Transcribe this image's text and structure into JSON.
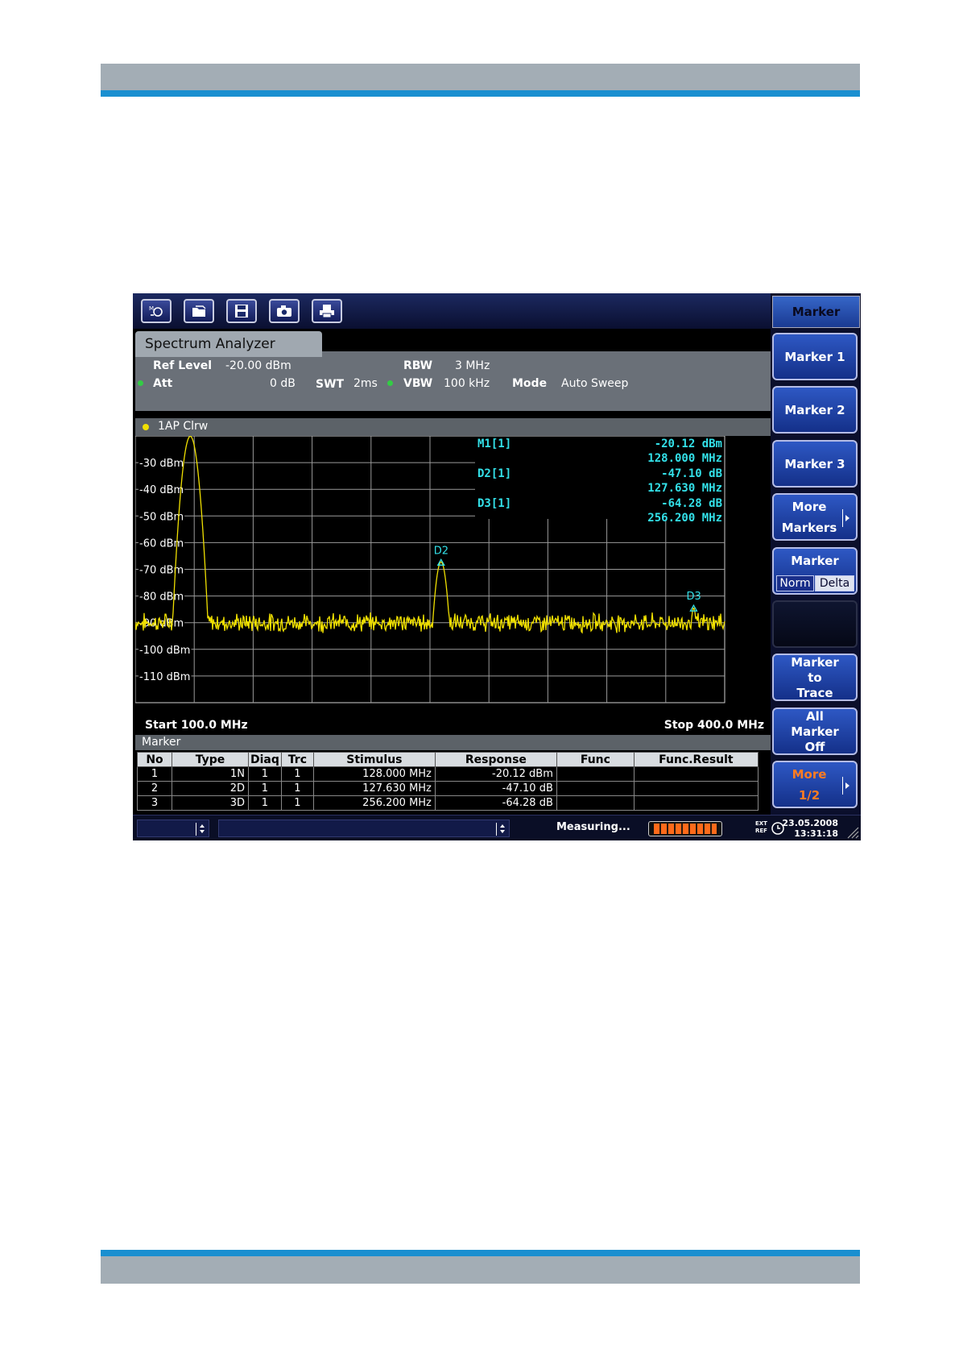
{
  "toolbar": {
    "buttons": [
      {
        "icon": "mode-icon"
      },
      {
        "icon": "open-file-icon"
      },
      {
        "icon": "save-icon"
      },
      {
        "icon": "screenshot-camera-icon"
      },
      {
        "icon": "print-icon"
      }
    ]
  },
  "tab": {
    "label": "Spectrum Analyzer"
  },
  "settings": {
    "ref_level_label": "Ref Level",
    "ref_level_value": "-20.00 dBm",
    "att_label": "Att",
    "att_value": "0 dB",
    "swt_label": "SWT",
    "swt_value": "2ms",
    "rbw_label": "RBW",
    "rbw_value": "3 MHz",
    "vbw_label": "VBW",
    "vbw_value": "100 kHz",
    "mode_label": "Mode",
    "mode_value": "Auto Sweep"
  },
  "trace": {
    "label": "1AP Clrw",
    "color": "#f0e000"
  },
  "marker_readout": [
    {
      "name": "M1[1]",
      "level": "-20.12 dBm",
      "freq": "128.000 MHz"
    },
    {
      "name": "D2[1]",
      "level": "-47.10 dB",
      "freq": "127.630 MHz"
    },
    {
      "name": "D3[1]",
      "level": "-64.28 dB",
      "freq": "256.200 MHz"
    }
  ],
  "chart_data": {
    "type": "line",
    "x_start_mhz": 100.0,
    "x_stop_mhz": 400.0,
    "start_label": "Start 100.0 MHz",
    "stop_label": "Stop 400.0 MHz",
    "y_tick_labels": [
      "-30 dBm",
      "-40 dBm",
      "-50 dBm",
      "-60 dBm",
      "-70 dBm",
      "-80 dBm",
      "-90 dBm",
      "-100 dBm",
      "-110 dBm"
    ],
    "y_tick_values": [
      -30,
      -40,
      -50,
      -60,
      -70,
      -80,
      -90,
      -100,
      -110
    ],
    "ylim": [
      -120,
      -20
    ],
    "noise_floor_dbm": -90,
    "peaks": [
      {
        "center_mhz": 128.0,
        "level_dbm": -20.12
      },
      {
        "center_mhz": 255.63,
        "level_dbm": -67.22
      },
      {
        "center_mhz": 384.2,
        "level_dbm": -84.4
      }
    ],
    "marker_labels": [
      {
        "label": "D2",
        "x_mhz": 255.63,
        "y_dbm": -67.22
      },
      {
        "label": "D3",
        "x_mhz": 384.2,
        "y_dbm": -84.4
      }
    ],
    "grid": true,
    "trace_color": "#f0e000",
    "marker_color": "#33e0e8"
  },
  "marker_table": {
    "title": "Marker",
    "columns": [
      "No",
      "Type",
      "Diaq",
      "Trc",
      "Stimulus",
      "Response",
      "Func",
      "Func.Result"
    ],
    "rows": [
      [
        "1",
        "1N",
        "1",
        "1",
        "128.000 MHz",
        "-20.12 dBm",
        "",
        ""
      ],
      [
        "2",
        "2D",
        "1",
        "1",
        "127.630 MHz",
        "-47.10 dB",
        "",
        ""
      ],
      [
        "3",
        "3D",
        "1",
        "1",
        "256.200 MHz",
        "-64.28 dB",
        "",
        ""
      ]
    ]
  },
  "softkeys": {
    "title": "Marker",
    "marker1": "Marker 1",
    "marker2": "Marker 2",
    "marker3": "Marker 3",
    "more_markers_1": "More",
    "more_markers_2": "Markers",
    "marker_mode": "Marker",
    "norm": "Norm",
    "delta": "Delta",
    "to_trace_1": "Marker",
    "to_trace_2": "to",
    "to_trace_3": "Trace",
    "all_off_1": "All",
    "all_off_2": "Marker",
    "all_off_3": "Off",
    "more_1": "More",
    "more_2": "1/2",
    "accent": "#ff7c22"
  },
  "status": {
    "measuring": "Measuring...",
    "progress": 0.85,
    "ext_ref_1": "EXT",
    "ext_ref_2": "REF",
    "date": "23.05.2008",
    "time": "13:31:18"
  }
}
